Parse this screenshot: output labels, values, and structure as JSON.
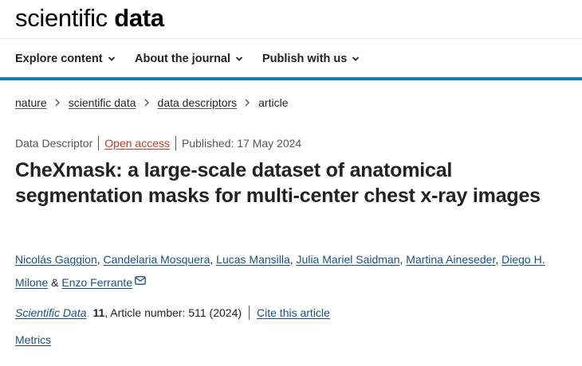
{
  "header": {
    "logo_part1": "scientific",
    "logo_part2": "data"
  },
  "nav": {
    "items": [
      {
        "label": "Explore content",
        "icon": "chevron-down-icon"
      },
      {
        "label": "About the journal",
        "icon": "chevron-down-icon"
      },
      {
        "label": "Publish with us",
        "icon": "chevron-down-icon"
      }
    ],
    "rule_color": "#0f7fb8"
  },
  "breadcrumb": {
    "items": [
      "nature",
      "scientific data",
      "data descriptors",
      "article"
    ]
  },
  "article": {
    "type": "Data Descriptor",
    "access": "Open access",
    "published": "Published: 17 May 2024",
    "title": "CheXmask: a large-scale dataset of anatomical segmentation masks for multi-center chest x-ray images",
    "authors": [
      "Nicolás Gaggion",
      "Candelaria Mosquera",
      "Lucas Mansilla",
      "Julia Mariel Saidman",
      "Martina Aineseder",
      "Diego H. Milone",
      "Enzo Ferrante"
    ],
    "author_sep": ",",
    "author_and": "&",
    "journal": "Scientific Data",
    "volume": "11",
    "article_number": ", Article number: 511 (2024)",
    "cite_label": "Cite this article",
    "metrics_label": "Metrics"
  },
  "colors": {
    "open_access": "#c0392b",
    "link": "#1b4f86",
    "accent": "#0f7fb8"
  }
}
